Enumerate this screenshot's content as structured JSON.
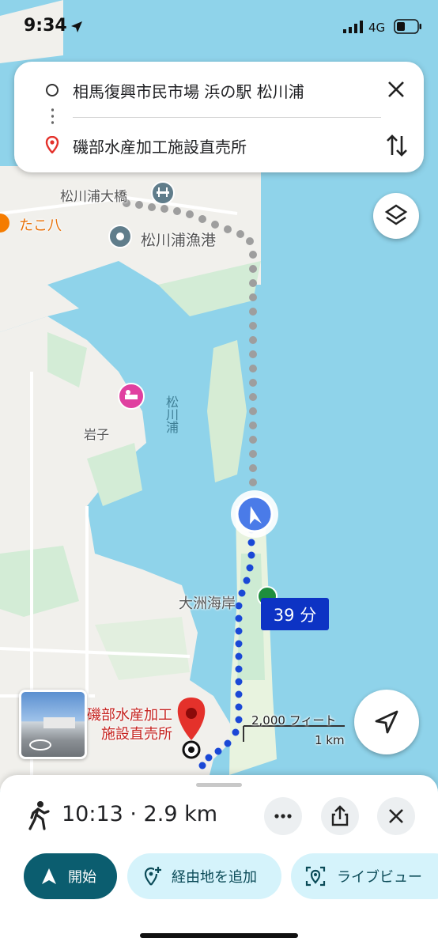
{
  "status_bar": {
    "time": "9:34",
    "network": "4G"
  },
  "directions": {
    "origin": "相馬復興市民市場 浜の駅 松川浦",
    "destination": "磯部水産加工施設直売所"
  },
  "map": {
    "labels": {
      "bridge": "松川浦大橋",
      "restaurant": "たこ八",
      "port": "松川浦漁港",
      "bay": "松川浦",
      "area": "岩子",
      "beach": "大洲海岸",
      "destination": "磯部水産加工施設直売所"
    },
    "route_duration": "39 分",
    "scale": {
      "imperial": "2,000 フィート",
      "metric": "1 km"
    }
  },
  "trip": {
    "mode_icon": "walk-icon",
    "summary": "10:13 · 2.9 km",
    "start_label": "開始",
    "add_stop_label": "経由地を追加",
    "live_view_label": "ライブビュー"
  },
  "colors": {
    "water": "#8fd3ea",
    "land": "#f1f0ec",
    "route_blue": "#1a48d6",
    "accent_teal": "#0b5d6f",
    "pill_bg": "#d5f3fb",
    "destination_red": "#e4312b"
  }
}
